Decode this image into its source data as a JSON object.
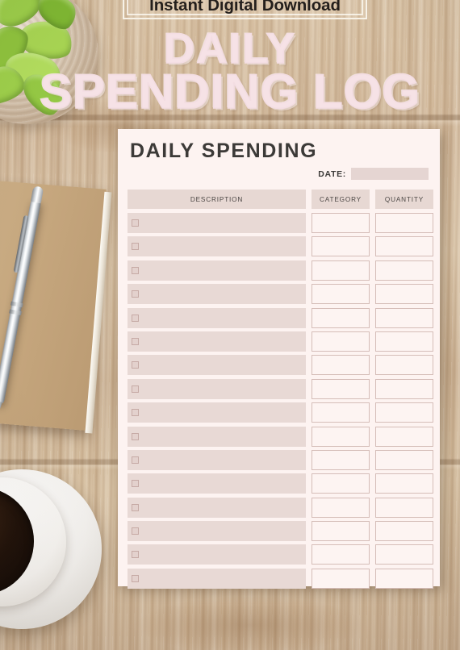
{
  "banner": {
    "text": "Instant Digital Download"
  },
  "hero": {
    "line1": "DAILY",
    "line2": "SPENDING LOG"
  },
  "sheet": {
    "title": "DAILY SPENDING",
    "date_label": "DATE:",
    "date_value": "",
    "columns": [
      {
        "key": "description",
        "label": "DESCRIPTION"
      },
      {
        "key": "category",
        "label": "CATEGORY"
      },
      {
        "key": "quantity",
        "label": "QUANTITY"
      }
    ],
    "row_count": 16,
    "rows": [
      {
        "checked": false,
        "description": "",
        "category": "",
        "quantity": ""
      },
      {
        "checked": false,
        "description": "",
        "category": "",
        "quantity": ""
      },
      {
        "checked": false,
        "description": "",
        "category": "",
        "quantity": ""
      },
      {
        "checked": false,
        "description": "",
        "category": "",
        "quantity": ""
      },
      {
        "checked": false,
        "description": "",
        "category": "",
        "quantity": ""
      },
      {
        "checked": false,
        "description": "",
        "category": "",
        "quantity": ""
      },
      {
        "checked": false,
        "description": "",
        "category": "",
        "quantity": ""
      },
      {
        "checked": false,
        "description": "",
        "category": "",
        "quantity": ""
      },
      {
        "checked": false,
        "description": "",
        "category": "",
        "quantity": ""
      },
      {
        "checked": false,
        "description": "",
        "category": "",
        "quantity": ""
      },
      {
        "checked": false,
        "description": "",
        "category": "",
        "quantity": ""
      },
      {
        "checked": false,
        "description": "",
        "category": "",
        "quantity": ""
      },
      {
        "checked": false,
        "description": "",
        "category": "",
        "quantity": ""
      },
      {
        "checked": false,
        "description": "",
        "category": "",
        "quantity": ""
      },
      {
        "checked": false,
        "description": "",
        "category": "",
        "quantity": ""
      },
      {
        "checked": false,
        "description": "",
        "category": "",
        "quantity": ""
      }
    ]
  },
  "colors": {
    "paper": "#fdf3f1",
    "header_fill": "#e7d8d3",
    "row_fill": "#e8d9d5",
    "box_border": "#d5bdb8",
    "title_text": "#3c3a38",
    "hero_pink": "#f6e2e6",
    "wood": "#cfb596",
    "banner_text": "#241f1c"
  },
  "scene": {
    "plant": "succulent-plant",
    "pot": "ceramic-pot",
    "notebook": "kraft-notebook",
    "pen": "silver-pen",
    "cup": "coffee-cup",
    "saucer": "saucer",
    "surface": "wood-desk"
  }
}
